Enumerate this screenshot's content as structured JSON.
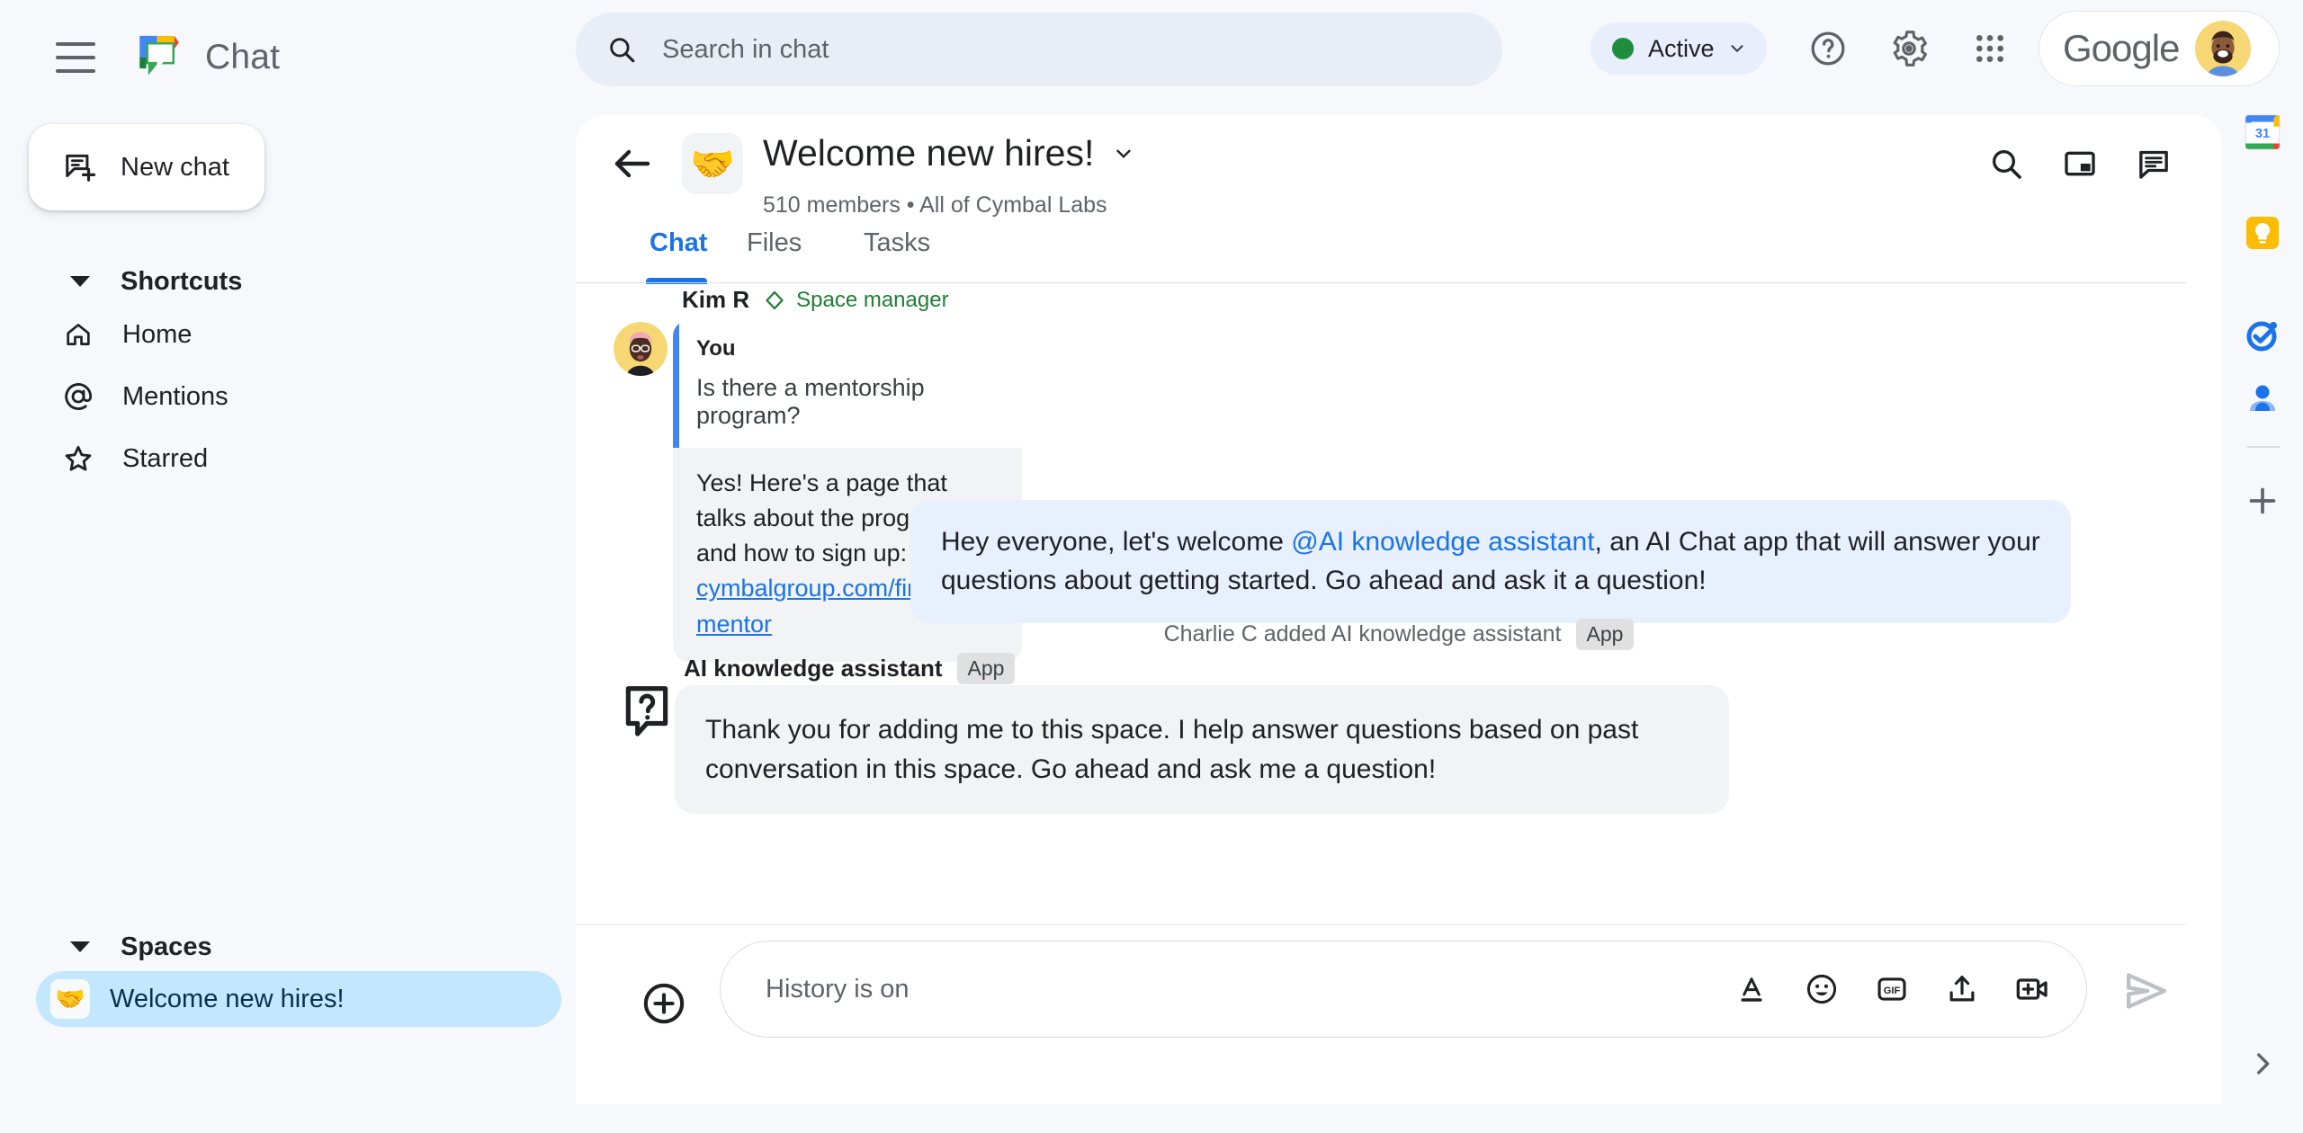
{
  "app": {
    "brand_title": "Chat",
    "logo_icon": "google-chat-logo"
  },
  "topbar": {
    "menu_icon": "hamburger-menu-icon",
    "search": {
      "icon": "search-icon",
      "placeholder": "Search in chat"
    },
    "status": {
      "label": "Active",
      "dot_color": "#1e8e3e",
      "caret_icon": "chevron-down-icon"
    },
    "help_icon": "help-circle-icon",
    "settings_icon": "gear-icon",
    "apps_icon": "apps-grid-icon",
    "account": {
      "wordmark": "Google",
      "avatar_icon": "user-avatar"
    }
  },
  "sidebar": {
    "new_chat": {
      "label": "New chat",
      "icon": "new-chat-icon"
    },
    "shortcuts": {
      "title": "Shortcuts",
      "caret_icon": "caret-down-icon",
      "items": [
        {
          "label": "Home",
          "icon": "home-icon"
        },
        {
          "label": "Mentions",
          "icon": "at-mention-icon"
        },
        {
          "label": "Starred",
          "icon": "star-icon"
        }
      ]
    },
    "spaces": {
      "title": "Spaces",
      "caret_icon": "caret-down-icon",
      "items": [
        {
          "label": "Welcome new hires!",
          "emoji": "🤝",
          "selected": true
        }
      ]
    }
  },
  "space": {
    "back_icon": "back-arrow-icon",
    "emoji": "🤝",
    "title": "Welcome new hires!",
    "title_caret_icon": "chevron-down-icon",
    "members": "510 members",
    "separator": "•",
    "org": "All of Cymbal Labs",
    "subtitle": "510 members  •  All of Cymbal Labs",
    "actions": [
      {
        "name": "search-in-space",
        "icon": "search-icon"
      },
      {
        "name": "picture-in-picture",
        "icon": "picture-in-picture-icon"
      },
      {
        "name": "open-chat-panel",
        "icon": "chat-bubble-icon"
      }
    ],
    "tabs": [
      {
        "label": "Chat",
        "active": true
      },
      {
        "label": "Files",
        "active": false
      },
      {
        "label": "Tasks",
        "active": false
      }
    ]
  },
  "conversation": {
    "messages": [
      {
        "type": "quoted-reply",
        "author": "Kim R",
        "role_badge": "Space manager",
        "role_badge_icon": "diamond-icon",
        "avatar_icon": "kim-avatar",
        "quote": {
          "author": "You",
          "text": "Is there a mentorship program?"
        },
        "body_prefix": "Yes! Here's a page that talks about the program and how to sign up: ",
        "link_text": "cymbalgroup.com/find-a-mentor"
      },
      {
        "type": "outgoing",
        "text_before": "Hey everyone, let's welcome ",
        "mention": "@AI knowledge assistant",
        "text_after": ", an AI Chat app that will answer your questions about getting started.  Go ahead and ask it a question!"
      },
      {
        "type": "system",
        "text": "Charlie C added AI knowledge assistant",
        "badge": "App"
      },
      {
        "type": "bot",
        "author": "AI knowledge assistant",
        "badge": "App",
        "avatar_icon": "question-bubble-icon",
        "text": "Thank you for adding me to this space. I help answer questions based on past conversation in this space. Go ahead and ask me a question!"
      }
    ]
  },
  "composer": {
    "add_icon": "plus-circle-icon",
    "placeholder": "History is on",
    "tools": [
      {
        "name": "format-text",
        "icon": "format-text-icon",
        "label": "A"
      },
      {
        "name": "insert-emoji",
        "icon": "emoji-icon"
      },
      {
        "name": "insert-gif",
        "icon": "gif-icon",
        "label": "GIF"
      },
      {
        "name": "upload-file",
        "icon": "upload-icon"
      },
      {
        "name": "add-video-meeting",
        "icon": "video-add-icon"
      }
    ],
    "send_icon": "send-icon"
  },
  "right_rail": {
    "items": [
      {
        "name": "google-calendar",
        "icon": "calendar-icon",
        "day": "31"
      },
      {
        "name": "google-keep",
        "icon": "keep-bulb-icon"
      },
      {
        "name": "google-tasks",
        "icon": "tasks-check-icon"
      },
      {
        "name": "google-contacts",
        "icon": "contacts-person-icon"
      }
    ],
    "add_icon": "plus-icon",
    "expand_icon": "chevron-right-icon"
  },
  "colors": {
    "page_bg": "#f6f8fc",
    "panel_bg": "#ffffff",
    "accent_blue": "#1a73e8",
    "selected_space": "#c2e7ff",
    "outgoing_bubble": "#e8f0fe",
    "bot_bubble": "#f1f3f4",
    "manager_green": "#1e7e34"
  }
}
